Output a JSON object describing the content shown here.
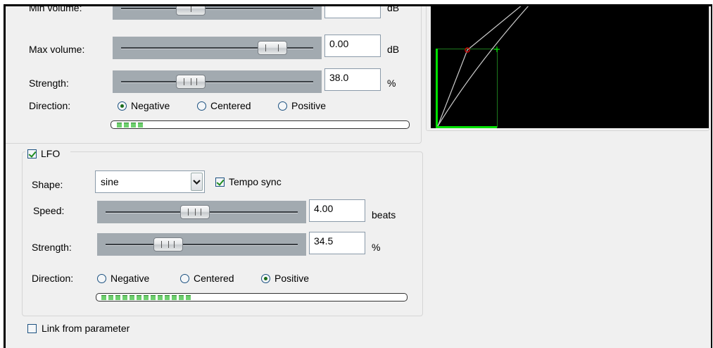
{
  "top_section": {
    "min_volume_label": "Min volume:",
    "min_volume_unit": "dB",
    "max_volume_label": "Max volume:",
    "max_volume_value": "0.00",
    "max_volume_unit": "dB",
    "strength_label": "Strength:",
    "strength_value": "38.0",
    "strength_unit": "%",
    "direction_label": "Direction:",
    "direction_options": [
      "Negative",
      "Centered",
      "Positive"
    ],
    "direction_selected": "Negative",
    "meter_segments_lit": 4
  },
  "lfo": {
    "checkbox_label": "LFO",
    "enabled": true,
    "shape_label": "Shape:",
    "shape_value": "sine",
    "tempo_sync_label": "Tempo sync",
    "tempo_sync_checked": true,
    "speed_label": "Speed:",
    "speed_value": "4.00",
    "speed_unit": "beats",
    "strength_label": "Strength:",
    "strength_value": "34.5",
    "strength_unit": "%",
    "direction_label": "Direction:",
    "direction_options": [
      "Negative",
      "Centered",
      "Positive"
    ],
    "direction_selected": "Positive",
    "meter_segments_lit": 11
  },
  "link": {
    "label": "Link from parameter",
    "checked": false
  },
  "colors": {
    "graph_background": "#000000",
    "graph_green": "#00e000",
    "graph_curve": "#cccccc",
    "graph_point": "#cc0000"
  }
}
